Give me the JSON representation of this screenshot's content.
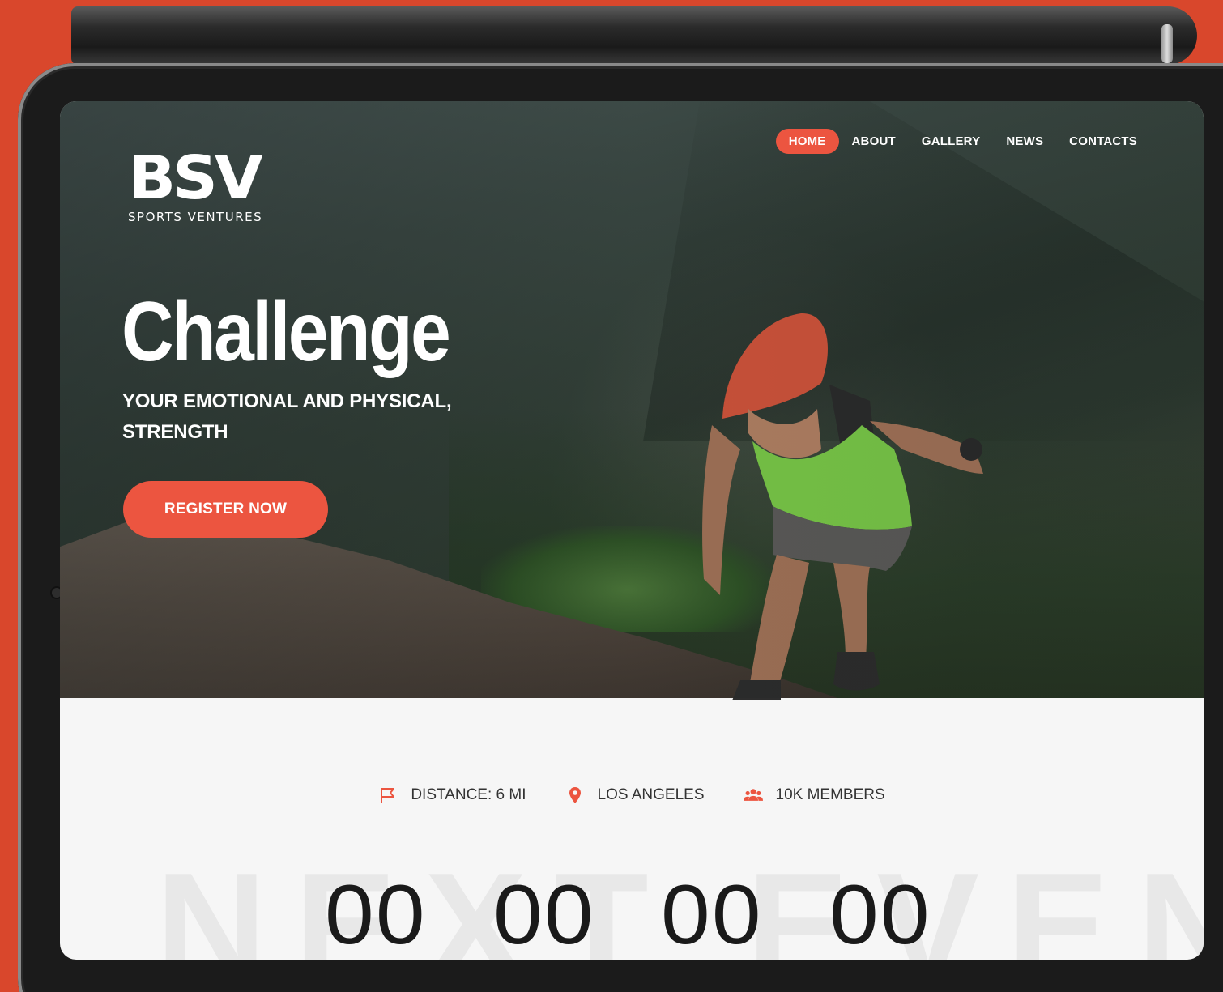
{
  "brand": {
    "logo_text": "BSV",
    "logo_subtitle": "SPORTS VENTURES"
  },
  "nav": {
    "items": [
      "HOME",
      "ABOUT",
      "GALLERY",
      "NEWS",
      "CONTACTS"
    ],
    "active": "HOME"
  },
  "hero": {
    "title": "Challenge",
    "subtitle": "YOUR EMOTIONAL AND PHYSICAL, STRENGTH",
    "cta_label": "REGISTER NOW"
  },
  "event_info": {
    "distance": "DISTANCE: 6 MI",
    "location": "LOS ANGELES",
    "members": "10K MEMBERS"
  },
  "countdown": {
    "background_word": "NEXT EVENT",
    "values": [
      "00",
      "00",
      "00",
      "00"
    ]
  },
  "colors": {
    "accent": "#ec5540",
    "backdrop": "#d9472c"
  }
}
